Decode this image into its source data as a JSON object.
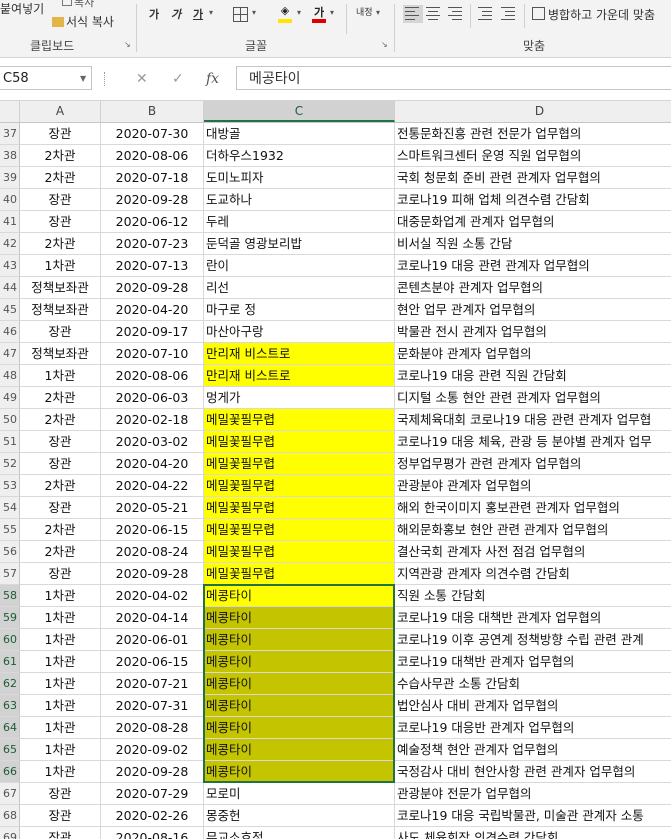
{
  "ribbon": {
    "clipboard": {
      "paste_label": "붙여넣기",
      "cut_label": "복사",
      "format_painter_label": "서식 복사",
      "group_label": "클립보드"
    },
    "font": {
      "group_label": "글꼴",
      "bold": "가",
      "italic": "가",
      "underline": "가",
      "font_color_glyph": "가"
    },
    "alignment": {
      "wrap_label": "내정",
      "merge_center_label": "병합하고 가운데 맞춤",
      "group_label": "맞춤"
    },
    "colors": {
      "highlight": "#ffe600",
      "font_color": "#e00000"
    }
  },
  "formula_bar": {
    "name_box": "C58",
    "fx_label": "fx",
    "formula": "메공타이"
  },
  "columns": [
    "A",
    "B",
    "C",
    "D"
  ],
  "selected_column": "C",
  "selection_range": "C58:C66",
  "rows": [
    {
      "num": "37",
      "a": "장관",
      "b": "2020-07-30",
      "c": "대방골",
      "d": "전통문화진흥 관련 전문가 업무협의",
      "fill": ""
    },
    {
      "num": "38",
      "a": "2차관",
      "b": "2020-08-06",
      "c": "더하우스1932",
      "d": "스마트워크센터 운영 직원 업무협의",
      "fill": ""
    },
    {
      "num": "39",
      "a": "2차관",
      "b": "2020-07-18",
      "c": "도미노피자",
      "d": "국회 청문회 준비 관련 관계자 업무협의",
      "fill": ""
    },
    {
      "num": "40",
      "a": "장관",
      "b": "2020-09-28",
      "c": "도교하나",
      "d": "코로나19 피해 업체 의견수렴 간담회",
      "fill": ""
    },
    {
      "num": "41",
      "a": "장관",
      "b": "2020-06-12",
      "c": "두레",
      "d": "대중문화업계 관계자 업무협의",
      "fill": ""
    },
    {
      "num": "42",
      "a": "2차관",
      "b": "2020-07-23",
      "c": "둔덕골 영광보리밥",
      "d": "비서실 직원 소통 간담",
      "fill": ""
    },
    {
      "num": "43",
      "a": "1차관",
      "b": "2020-07-13",
      "c": "란이",
      "d": "코로나19 대응 관련 관계자 업무협의",
      "fill": ""
    },
    {
      "num": "44",
      "a": "정책보좌관",
      "b": "2020-09-28",
      "c": "리선",
      "d": "콘텐츠분야 관계자 업무협의",
      "fill": ""
    },
    {
      "num": "45",
      "a": "정책보좌관",
      "b": "2020-04-20",
      "c": "마구로 정",
      "d": "현안 업무 관계자 업무협의",
      "fill": ""
    },
    {
      "num": "46",
      "a": "장관",
      "b": "2020-09-17",
      "c": "마산아구랑",
      "d": "박물관 전시 관계자 업무협의",
      "fill": ""
    },
    {
      "num": "47",
      "a": "정책보좌관",
      "b": "2020-07-10",
      "c": "만리재 비스트로",
      "d": "문화분야 관계자 업무협의",
      "fill": "yellow"
    },
    {
      "num": "48",
      "a": "1차관",
      "b": "2020-08-06",
      "c": "만리재 비스트로",
      "d": "코로나19 대응 관련 직원 간담회",
      "fill": "yellow"
    },
    {
      "num": "49",
      "a": "2차관",
      "b": "2020-06-03",
      "c": "멍게가",
      "d": "디지털 소통 현안 관련 관계자 업무협의",
      "fill": ""
    },
    {
      "num": "50",
      "a": "2차관",
      "b": "2020-02-18",
      "c": "메밀꽃필무렵",
      "d": "국제체육대회 코로나19 대응 관련 관계자 업무협",
      "fill": "yellow"
    },
    {
      "num": "51",
      "a": "장관",
      "b": "2020-03-02",
      "c": "메밀꽃필무렵",
      "d": "코로나19 대응 체육, 관광 등 분야별 관계자 업무",
      "fill": "yellow"
    },
    {
      "num": "52",
      "a": "장관",
      "b": "2020-04-20",
      "c": "메밀꽃필무렵",
      "d": "정부업무평가 관련 관계자 업무협의",
      "fill": "yellow"
    },
    {
      "num": "53",
      "a": "2차관",
      "b": "2020-04-22",
      "c": "메밀꽃필무렵",
      "d": "관광분야 관계자 업무협의",
      "fill": "yellow"
    },
    {
      "num": "54",
      "a": "장관",
      "b": "2020-05-21",
      "c": "메밀꽃필무렵",
      "d": "해외 한국이미지 홍보관련 관계자 업무협의",
      "fill": "yellow"
    },
    {
      "num": "55",
      "a": "2차관",
      "b": "2020-06-15",
      "c": "메밀꽃필무렵",
      "d": "해외문화홍보 현안 관련 관계자 업무협의",
      "fill": "yellow"
    },
    {
      "num": "56",
      "a": "2차관",
      "b": "2020-08-24",
      "c": "메밀꽃필무렵",
      "d": "결산국회 관계자 사전 점검 업무협의",
      "fill": "yellow"
    },
    {
      "num": "57",
      "a": "장관",
      "b": "2020-09-28",
      "c": "메밀꽃필무렵",
      "d": "지역관광 관계자 의견수렴 간담회",
      "fill": "yellow"
    },
    {
      "num": "58",
      "a": "1차관",
      "b": "2020-04-02",
      "c": "메콩타이",
      "d": "직원 소통 간담회",
      "fill": "yellow"
    },
    {
      "num": "59",
      "a": "1차관",
      "b": "2020-04-14",
      "c": "메콩타이",
      "d": "코로나19 대응 대책반 관계자 업무협의",
      "fill": "olive"
    },
    {
      "num": "60",
      "a": "1차관",
      "b": "2020-06-01",
      "c": "메콩타이",
      "d": "코로나19 이후 공연계 정책방향 수립 관련 관계",
      "fill": "olive"
    },
    {
      "num": "61",
      "a": "1차관",
      "b": "2020-06-15",
      "c": "메콩타이",
      "d": "코로나19 대책반 관계자 업무협의",
      "fill": "olive"
    },
    {
      "num": "62",
      "a": "1차관",
      "b": "2020-07-21",
      "c": "메콩타이",
      "d": "수습사무관 소통 간담회",
      "fill": "olive"
    },
    {
      "num": "63",
      "a": "1차관",
      "b": "2020-07-31",
      "c": "메콩타이",
      "d": "법안심사 대비 관계자 업무협의",
      "fill": "olive"
    },
    {
      "num": "64",
      "a": "1차관",
      "b": "2020-08-28",
      "c": "메콩타이",
      "d": "코로나19 대응반 관계자 업무협의",
      "fill": "olive"
    },
    {
      "num": "65",
      "a": "1차관",
      "b": "2020-09-02",
      "c": "메콩타이",
      "d": "예술정책 현안 관계자 업무협의",
      "fill": "olive"
    },
    {
      "num": "66",
      "a": "1차관",
      "b": "2020-09-28",
      "c": "메콩타이",
      "d": "국정감사 대비 현안사항 관련 관계자 업무협의",
      "fill": "olive"
    },
    {
      "num": "67",
      "a": "장관",
      "b": "2020-07-29",
      "c": "모로미",
      "d": "관광분야 전문가 업무협의",
      "fill": ""
    },
    {
      "num": "68",
      "a": "장관",
      "b": "2020-02-26",
      "c": "몽중헌",
      "d": "코로나19 대응 국립박물관, 미술관 관계자 소통",
      "fill": ""
    },
    {
      "num": "69",
      "a": "장관",
      "b": "2020-08-16",
      "c": "무교소호정",
      "d": "사도 체육회장 의견수렴 간담회",
      "fill": ""
    }
  ]
}
